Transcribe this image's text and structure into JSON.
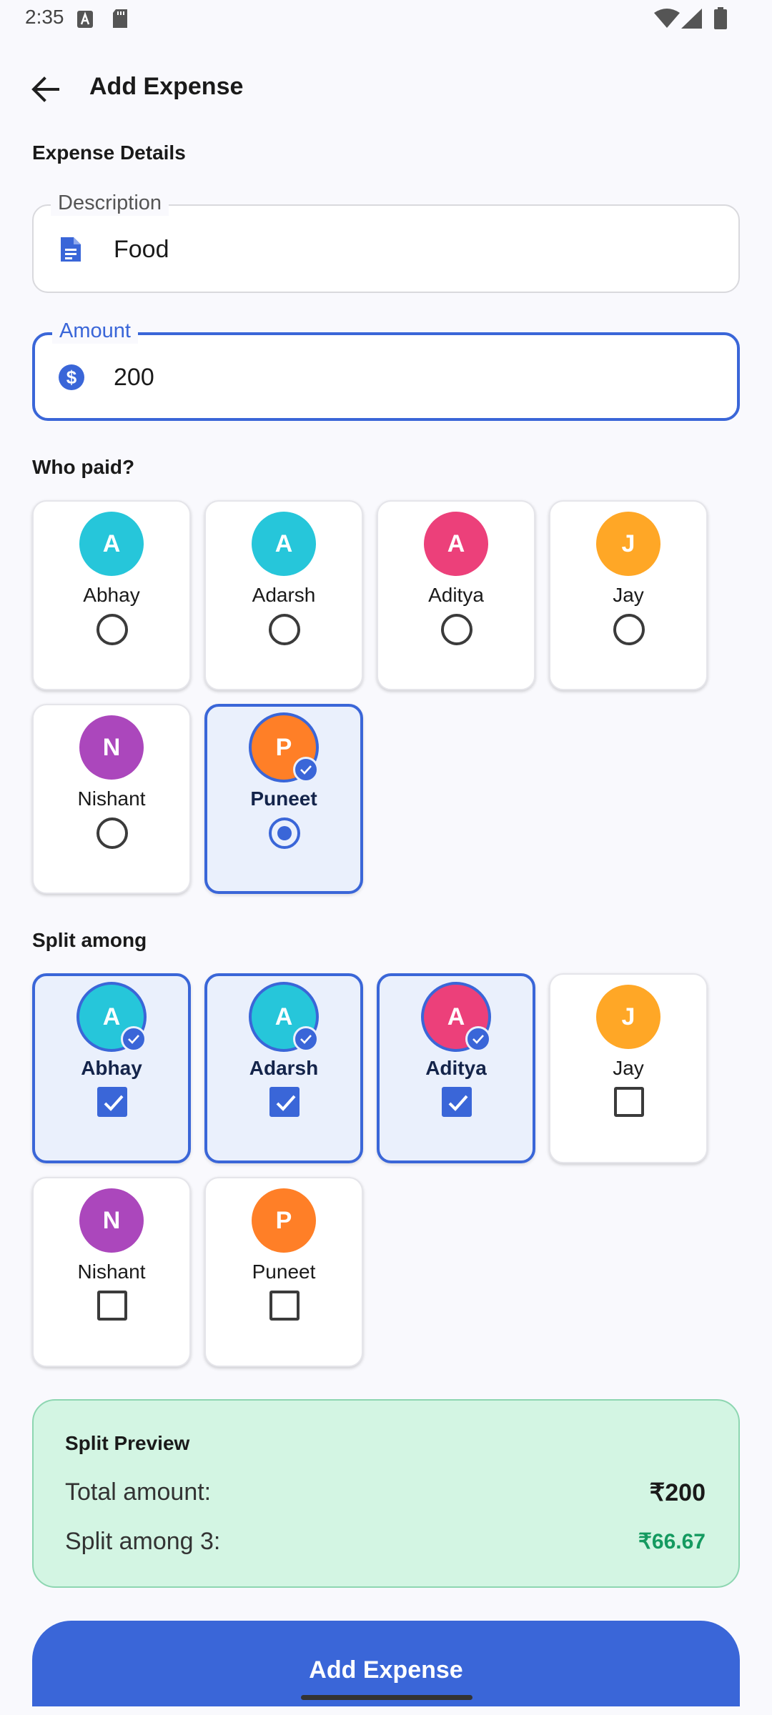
{
  "status_bar": {
    "time": "2:35"
  },
  "app_bar": {
    "title": "Add Expense"
  },
  "section_expense_details": "Expense Details",
  "description_field": {
    "label": "Description",
    "value": "Food"
  },
  "amount_field": {
    "label": "Amount",
    "value": "200"
  },
  "who_paid": {
    "title": "Who paid?",
    "people": [
      {
        "initial": "A",
        "name": "Abhay",
        "color": "#26c6da",
        "selected": false
      },
      {
        "initial": "A",
        "name": "Adarsh",
        "color": "#26c6da",
        "selected": false
      },
      {
        "initial": "A",
        "name": "Aditya",
        "color": "#ec407a",
        "selected": false
      },
      {
        "initial": "J",
        "name": "Jay",
        "color": "#ffa726",
        "selected": false
      },
      {
        "initial": "N",
        "name": "Nishant",
        "color": "#ab47bc",
        "selected": false
      },
      {
        "initial": "P",
        "name": "Puneet",
        "color": "#ff7f27",
        "selected": true
      }
    ]
  },
  "split_among": {
    "title": "Split among",
    "people": [
      {
        "initial": "A",
        "name": "Abhay",
        "color": "#26c6da",
        "selected": true
      },
      {
        "initial": "A",
        "name": "Adarsh",
        "color": "#26c6da",
        "selected": true
      },
      {
        "initial": "A",
        "name": "Aditya",
        "color": "#ec407a",
        "selected": true
      },
      {
        "initial": "J",
        "name": "Jay",
        "color": "#ffa726",
        "selected": false
      },
      {
        "initial": "N",
        "name": "Nishant",
        "color": "#ab47bc",
        "selected": false
      },
      {
        "initial": "P",
        "name": "Puneet",
        "color": "#ff7f27",
        "selected": false
      }
    ]
  },
  "split_preview": {
    "title": "Split Preview",
    "total_label": "Total amount:",
    "total_value": "₹200",
    "split_label": "Split among 3:",
    "split_value": "₹66.67"
  },
  "add_button": {
    "label": "Add Expense"
  },
  "colors": {
    "primary": "#3a66d8",
    "preview_bg": "#d3f5e3",
    "split_value_color": "#149a60"
  }
}
